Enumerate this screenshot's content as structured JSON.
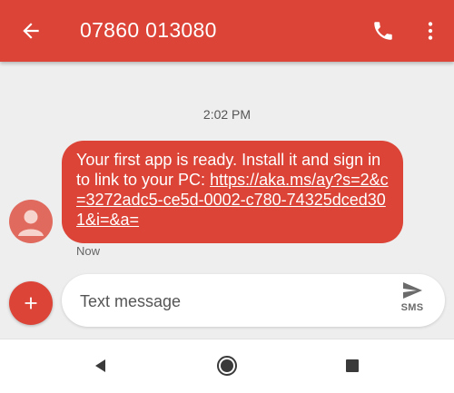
{
  "header": {
    "title": "07860 013080",
    "icons": [
      "arrow-back-icon",
      "phone-icon",
      "more-vert-icon"
    ]
  },
  "conversation": {
    "timestamp": "2:02 PM",
    "message": {
      "text": "Your first app is ready. Install it and sign in to link to your PC: ",
      "link": "https://aka.ms/ay?s=2&c=3272adc5-ce5d-0002-c780-74325dced301&i=&a=",
      "time": "Now"
    }
  },
  "compose": {
    "placeholder": "Text message",
    "value": "",
    "send_label": "SMS"
  },
  "navbar": {
    "icons": [
      "nav-back-icon",
      "nav-home-icon",
      "nav-recents-icon"
    ]
  },
  "colors": {
    "accent": "#db4437",
    "background": "#eeeeee",
    "navbar": "#ffffff"
  }
}
